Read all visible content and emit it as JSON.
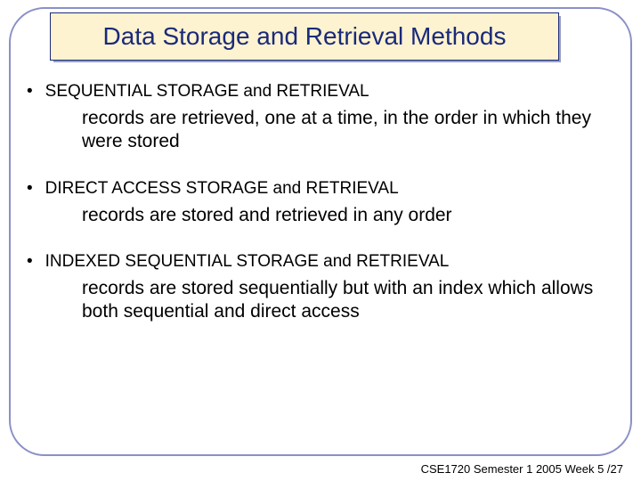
{
  "title": "Data Storage and Retrieval Methods",
  "items": [
    {
      "heading": "SEQUENTIAL STORAGE and RETRIEVAL",
      "description": "records are retrieved, one at a time, in the order in which they were stored"
    },
    {
      "heading": "DIRECT ACCESS STORAGE and RETRIEVAL",
      "description": "records are stored and retrieved in any order"
    },
    {
      "heading": "INDEXED SEQUENTIAL STORAGE and RETRIEVAL",
      "description": "records are stored sequentially but with an index which allows both sequential and direct access"
    }
  ],
  "footer": "CSE1720  Semester 1 2005  Week 5 /27"
}
